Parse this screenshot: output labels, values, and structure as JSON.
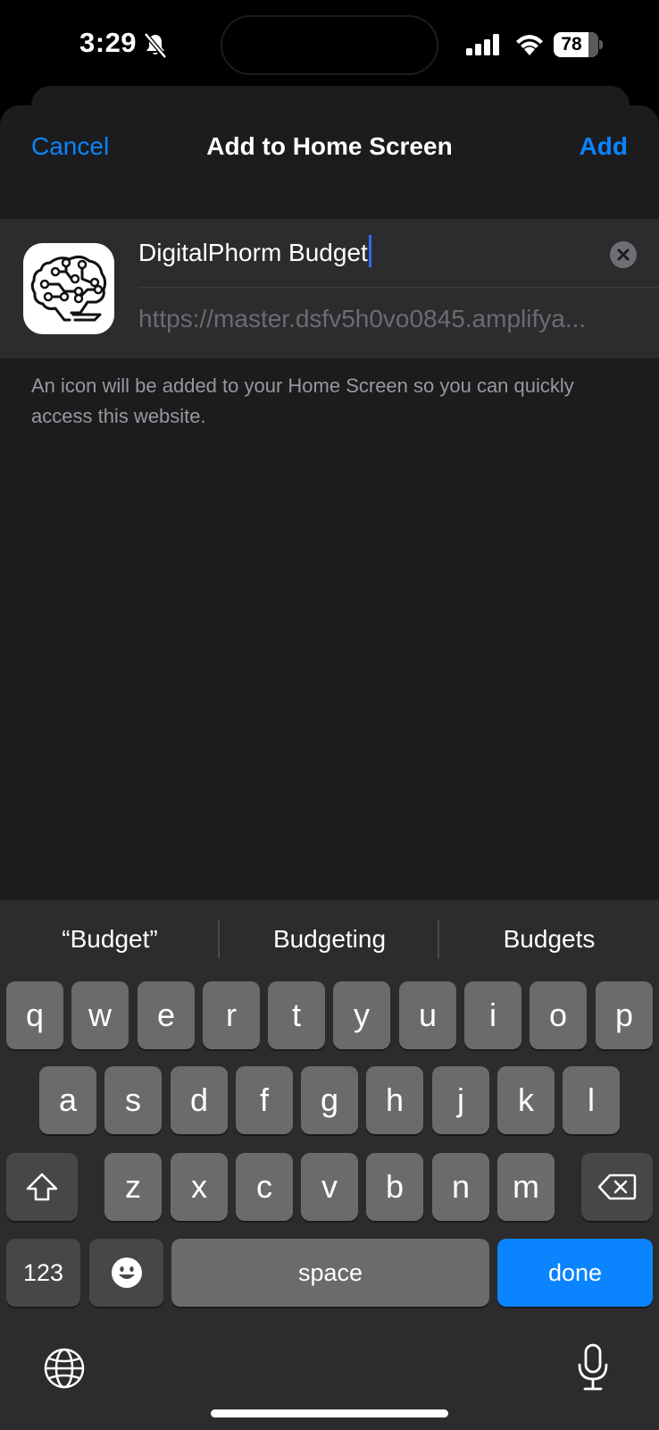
{
  "status_bar": {
    "time": "3:29",
    "battery": "78"
  },
  "nav": {
    "cancel": "Cancel",
    "title": "Add to Home Screen",
    "add": "Add"
  },
  "form": {
    "name_value": "DigitalPhorm Budget",
    "url_value": "https://master.dsfv5h0vo0845.amplifya..."
  },
  "info_text": "An icon will be added to your Home Screen so you can quickly access this website.",
  "keyboard": {
    "suggestions": [
      "“Budget”",
      "Budgeting",
      "Budgets"
    ],
    "row1": [
      "q",
      "w",
      "e",
      "r",
      "t",
      "y",
      "u",
      "i",
      "o",
      "p"
    ],
    "row2": [
      "a",
      "s",
      "d",
      "f",
      "g",
      "h",
      "j",
      "k",
      "l"
    ],
    "row3": [
      "z",
      "x",
      "c",
      "v",
      "b",
      "n",
      "m"
    ],
    "num_label": "123",
    "space_label": "space",
    "done_label": "done"
  },
  "colors": {
    "accent": "#0a84ff",
    "sheet": "#1c1c1e",
    "card": "#2c2c2e"
  }
}
